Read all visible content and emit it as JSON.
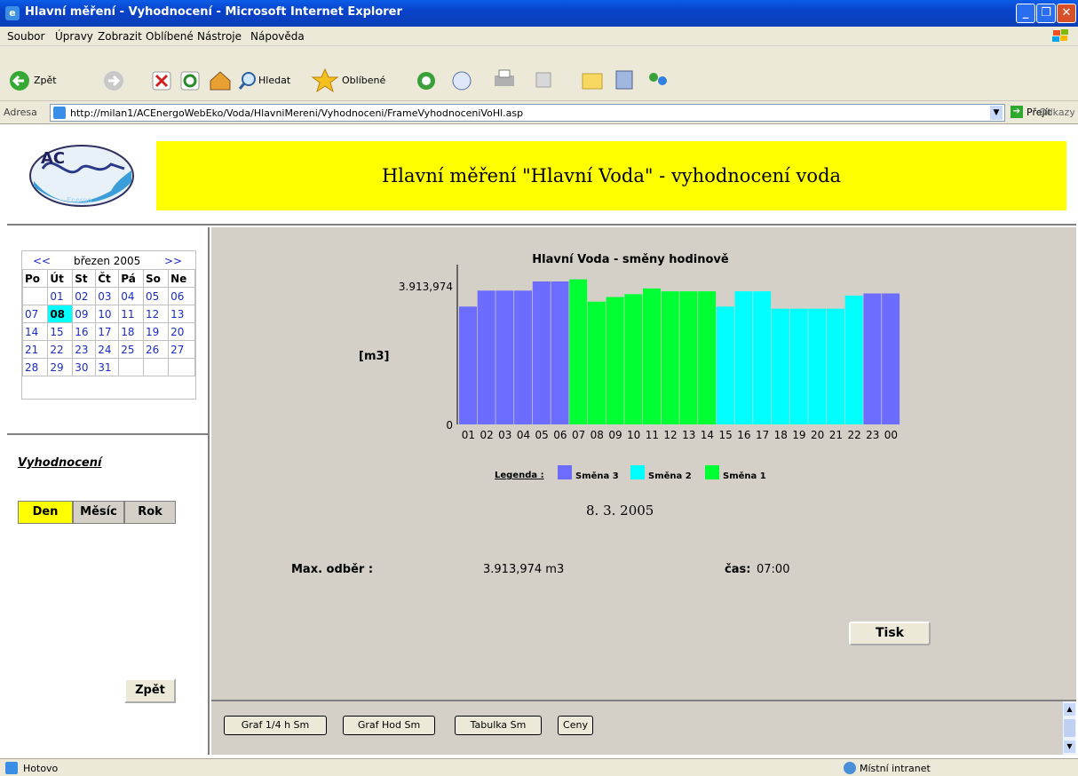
{
  "window": {
    "title": "Hlavní měření - Vyhodnocení - Microsoft Internet Explorer"
  },
  "menu": [
    "Soubor",
    "Úpravy",
    "Zobrazit",
    "Oblíbené",
    "Nástroje",
    "Nápověda"
  ],
  "toolbar": {
    "back_label": "Zpět",
    "search_label": "Hledat",
    "favorites_label": "Oblíbené"
  },
  "address": {
    "label": "Adresa",
    "url": "http://milan1/ACEnergoWebEko/Voda/HlavniMereni/Vyhodnoceni/FrameVyhodnoceniVoHl.asp",
    "go_label": "Přejít",
    "links_label": "Odkazy"
  },
  "logo": {
    "text": "AC",
    "subtext": "Energo"
  },
  "page_title": "Hlavní měření \"Hlavní Voda\" - vyhodnocení voda",
  "calendar": {
    "prev": "<<",
    "next": ">>",
    "month": "březen 2005",
    "dow": [
      "Po",
      "Út",
      "St",
      "Čt",
      "Pá",
      "So",
      "Ne"
    ],
    "weeks": [
      [
        "",
        "01",
        "02",
        "03",
        "04",
        "05",
        "06"
      ],
      [
        "07",
        "08",
        "09",
        "10",
        "11",
        "12",
        "13"
      ],
      [
        "14",
        "15",
        "16",
        "17",
        "18",
        "19",
        "20"
      ],
      [
        "21",
        "22",
        "23",
        "24",
        "25",
        "26",
        "27"
      ],
      [
        "28",
        "29",
        "30",
        "31",
        "",
        "",
        ""
      ]
    ],
    "selected": "08"
  },
  "nav": {
    "section": "Vyhodnocení",
    "day": "Den",
    "month": "Měsíc",
    "year": "Rok",
    "back": "Zpět"
  },
  "chart_data": {
    "type": "bar",
    "title": "Hlavní Voda - směny hodinově",
    "ylabel": "[m3]",
    "ylim": [
      0,
      3.913974
    ],
    "y_ticks": [
      "3.913,974",
      "0"
    ],
    "categories": [
      "01",
      "02",
      "03",
      "04",
      "05",
      "06",
      "07",
      "08",
      "09",
      "10",
      "11",
      "12",
      "13",
      "14",
      "15",
      "16",
      "17",
      "18",
      "19",
      "20",
      "21",
      "22",
      "23",
      "00"
    ],
    "values": [
      3.33,
      3.78,
      3.78,
      3.78,
      4.04,
      4.04,
      4.1,
      3.47,
      3.6,
      3.68,
      3.84,
      3.76,
      3.76,
      3.76,
      3.33,
      3.76,
      3.76,
      3.27,
      3.27,
      3.27,
      3.27,
      3.64,
      3.7,
      3.7
    ],
    "shift_of_bar": [
      3,
      3,
      3,
      3,
      3,
      3,
      1,
      1,
      1,
      1,
      1,
      1,
      1,
      1,
      2,
      2,
      2,
      2,
      2,
      2,
      2,
      2,
      3,
      3
    ],
    "legend_title": "Legenda :",
    "legend": [
      {
        "name": "Směna 3",
        "color": "#6c6cff"
      },
      {
        "name": "Směna 2",
        "color": "#00ffff"
      },
      {
        "name": "Směna 1",
        "color": "#00ff33"
      }
    ]
  },
  "date": "8. 3. 2005",
  "max": {
    "label": "Max. odběr :",
    "value": "3.913,974 m3",
    "time_label": "čas:",
    "time": "07:00"
  },
  "print_label": "Tisk",
  "bottom_buttons": [
    "Graf 1/4 h Sm",
    "Graf Hod Sm",
    "Tabulka Sm",
    "Ceny"
  ],
  "status": {
    "text": "Hotovo",
    "zone": "Místní intranet"
  }
}
